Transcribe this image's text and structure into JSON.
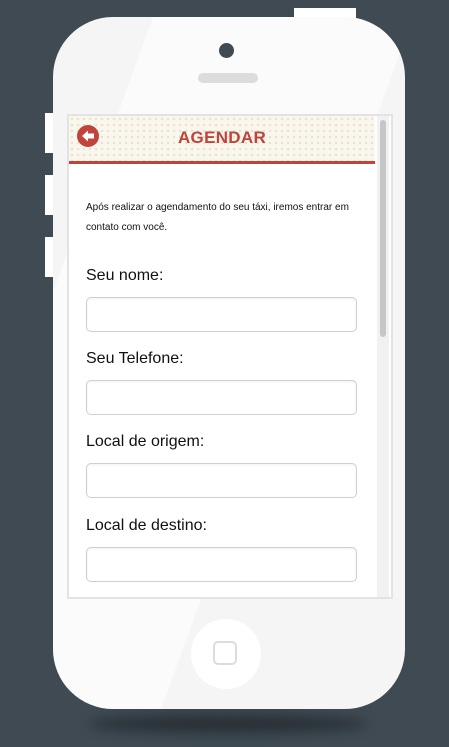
{
  "header": {
    "title": "AGENDAR",
    "back_icon": "arrow-left-icon"
  },
  "intro_text": "Após realizar o agendamento do seu táxi, iremos entrar em contato com você.",
  "form": {
    "fields": [
      {
        "label": "Seu nome:",
        "value": ""
      },
      {
        "label": "Seu Telefone:",
        "value": ""
      },
      {
        "label": "Local de origem:",
        "value": ""
      },
      {
        "label": "Local de destino:",
        "value": ""
      }
    ]
  },
  "colors": {
    "accent": "#c0433c",
    "background": "#3f4a53",
    "phone_body": "#f5f5f5"
  }
}
